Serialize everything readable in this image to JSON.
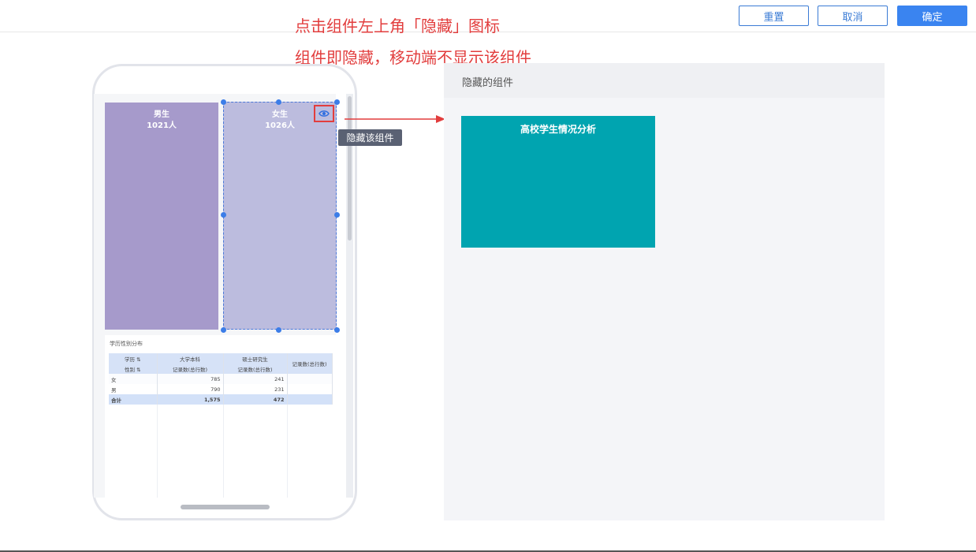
{
  "toolbar": {
    "reset_label": "重置",
    "cancel_label": "取消",
    "confirm_label": "确定"
  },
  "annotations": {
    "line1": "点击组件左上角「隐藏」图标",
    "line2": "组件即隐藏，移动端不显示该组件"
  },
  "phone": {
    "male_block": {
      "title": "男生",
      "value": "1021人"
    },
    "female_block": {
      "title": "女生",
      "value": "1026人"
    },
    "hide_tooltip": "隐藏该组件",
    "table": {
      "title": "学历性别分布",
      "header_row1": [
        "学历",
        "大学本科",
        "硕士研究生",
        "记录数(总行数)"
      ],
      "header_row2": [
        "性别",
        "记录数(总行数)",
        "记录数(总行数)"
      ],
      "rows": [
        {
          "label": "女",
          "v1": "785",
          "v2": "241",
          "v3": ""
        },
        {
          "label": "男",
          "v1": "790",
          "v2": "231",
          "v3": ""
        }
      ],
      "total": {
        "label": "合计",
        "v1": "1,575",
        "v2": "472",
        "v3": ""
      }
    }
  },
  "hidden_panel": {
    "title": "隐藏的组件",
    "card_title": "高校学生情况分析"
  },
  "colors": {
    "accent": "#3a84f0",
    "annotation": "#e23d3d",
    "teal": "#00a4b0",
    "male": "#a69acb",
    "female": "#bcbcde"
  },
  "icons": {
    "hide": "eye-icon",
    "sort": "sort-icon"
  }
}
